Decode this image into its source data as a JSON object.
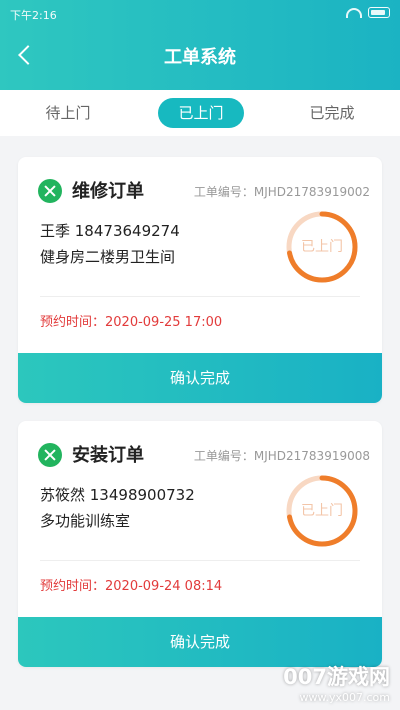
{
  "status_bar": {
    "time": "下午2:16"
  },
  "header": {
    "title": "工单系统"
  },
  "tabs": [
    {
      "label": "待上门",
      "active": false
    },
    {
      "label": "已上门",
      "active": true
    },
    {
      "label": "已完成",
      "active": false
    }
  ],
  "orders": [
    {
      "type": "维修订单",
      "order_no": "工单编号：MJHD21783919002",
      "contact": "王季 18473649274",
      "location": "健身房二楼男卫生间",
      "status": "已上门",
      "appointment": "预约时间：2020-09-25 17:00",
      "confirm_label": "确认完成",
      "progress": 0.72
    },
    {
      "type": "安装订单",
      "order_no": "工单编号：MJHD21783919008",
      "contact": "苏筱然 13498900732",
      "location": "多功能训练室",
      "status": "已上门",
      "appointment": "预约时间：2020-09-24 08:14",
      "confirm_label": "确认完成",
      "progress": 0.72
    }
  ],
  "watermark": {
    "name": "007游戏网",
    "url": "www.yx007.com"
  },
  "colors": {
    "accent": "#17b9c0",
    "ring": "#ef7d2a",
    "ring_track": "#f8d8c3",
    "appointment": "#e23b3b",
    "icon_green": "#22b45e"
  },
  "icons": {
    "back": "chevron-left-icon",
    "order_type": "tools-icon",
    "wifi": "wifi-icon",
    "battery": "battery-icon"
  }
}
